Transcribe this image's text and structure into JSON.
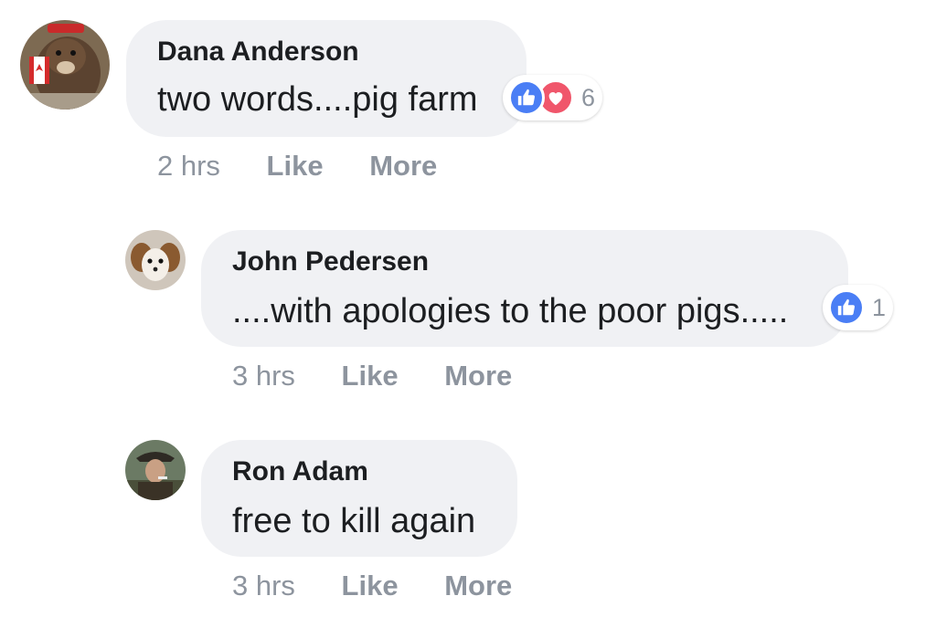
{
  "comments": [
    {
      "author": "Dana Anderson",
      "text": "two words....pig farm",
      "time": "2 hrs",
      "like_label": "Like",
      "more_label": "More",
      "reaction_count": "6",
      "reactions": [
        "like",
        "love"
      ]
    },
    {
      "author": "John Pedersen",
      "text": "....with apologies to the poor pigs.....",
      "time": "3 hrs",
      "like_label": "Like",
      "more_label": "More",
      "reaction_count": "1",
      "reactions": [
        "like"
      ]
    },
    {
      "author": "Ron Adam",
      "text": "free to kill again",
      "time": "3 hrs",
      "like_label": "Like",
      "more_label": "More"
    }
  ],
  "colors": {
    "bubble": "#f0f1f4",
    "meta_text": "#8d949e",
    "like_blue": "#4a7ef5",
    "love_red": "#f0566b"
  },
  "icons": [
    "thumbs-up-icon",
    "heart-icon"
  ]
}
